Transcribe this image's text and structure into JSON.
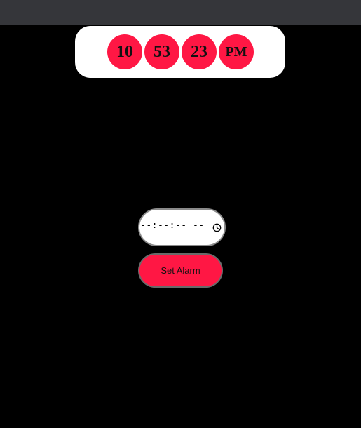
{
  "clock": {
    "hours": "10",
    "minutes": "53",
    "seconds": "23",
    "period": "PM"
  },
  "alarm": {
    "time_placeholder": "--:--:-- --",
    "time_icon": "clock-icon",
    "set_button_label": "Set Alarm"
  },
  "colors": {
    "accent": "#ff1744",
    "background": "#000000",
    "card": "#ffffff",
    "browser_bar": "#35363a"
  }
}
